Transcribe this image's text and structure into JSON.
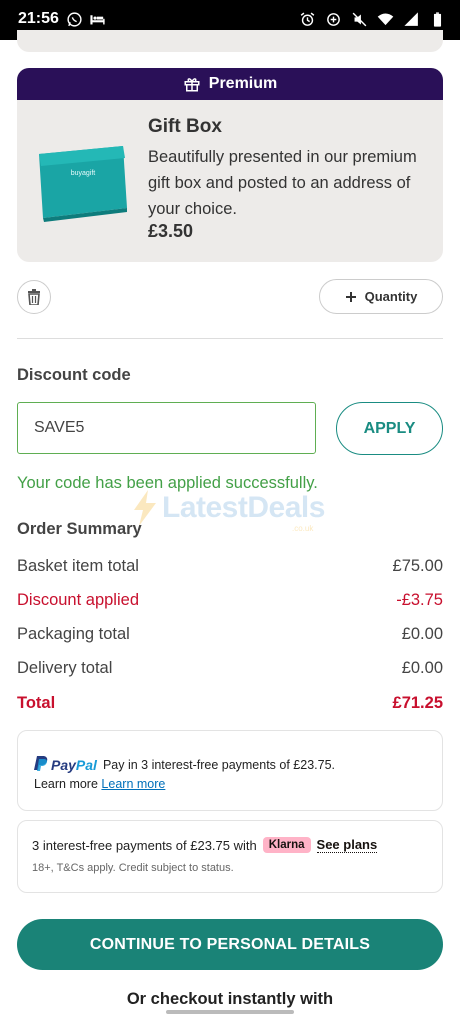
{
  "status_bar": {
    "time": "21:56",
    "left_icons": [
      "whatsapp-icon",
      "bed-icon"
    ],
    "right_icons": [
      "alarm-icon",
      "data-saver-icon",
      "mute-icon",
      "wifi-icon",
      "signal-icon",
      "battery-icon"
    ]
  },
  "premium": {
    "header_label": "Premium",
    "header_icon": "gift-icon",
    "product_title": "Gift Box",
    "product_description": "Beautifully presented in our premium gift box and posted to an address of your choice.",
    "product_price": "£3.50",
    "box_brand": "buyagift",
    "colors": {
      "header_bg": "#2a1058",
      "card_bg": "#edebe9",
      "box_teal": "#1aa5a5"
    }
  },
  "item_actions": {
    "delete_icon": "trash-icon",
    "quantity_label": "Quantity",
    "quantity_icon": "plus-icon"
  },
  "discount": {
    "label": "Discount code",
    "input_value": "SAVE5",
    "apply_label": "APPLY",
    "success_message": "Your code has been applied successfully."
  },
  "watermark": {
    "text": "LatestDeals",
    "sub": ".co.uk"
  },
  "order_summary": {
    "title": "Order Summary",
    "rows": [
      {
        "label": "Basket item total",
        "value": "£75.00"
      },
      {
        "label": "Discount applied",
        "value": "-£3.75"
      },
      {
        "label": "Packaging total",
        "value": "£0.00"
      },
      {
        "label": "Delivery total",
        "value": "£0.00"
      }
    ],
    "total": {
      "label": "Total",
      "value": "£71.25"
    },
    "colors": {
      "discount": "#c8102e",
      "total": "#c8102e"
    }
  },
  "paypal": {
    "brand_pay": "Pay",
    "brand_pal": "Pal",
    "message": "Pay in 3 interest-free payments of £23.75.",
    "learn_more_prefix": "Learn more",
    "learn_more_link": "Learn more"
  },
  "klarna": {
    "message": "3 interest-free payments of £23.75 with",
    "badge": "Klarna",
    "see_plans": "See plans",
    "disclaimer": "18+, T&Cs apply. Credit subject to status."
  },
  "actions": {
    "continue_label": "CONTINUE TO PERSONAL DETAILS",
    "or_checkout": "Or checkout instantly with",
    "colors": {
      "primary": "#1a8377"
    }
  }
}
